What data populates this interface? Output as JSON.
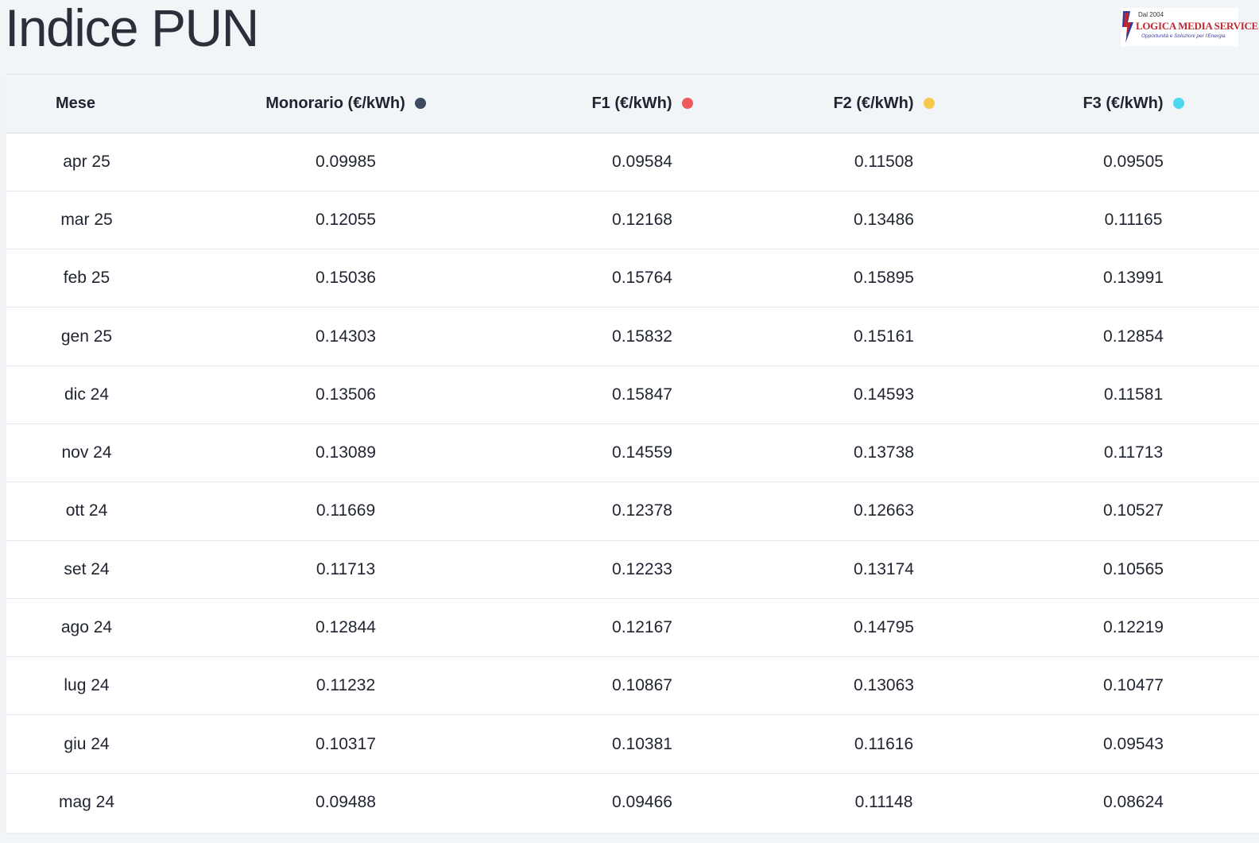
{
  "page": {
    "title": "Indice PUN"
  },
  "logo": {
    "since": "Dal 2004",
    "name": "LOGICA MEDIA SERVICE",
    "tagline": "Opportunità e Soluzioni per l'Energia"
  },
  "table": {
    "headers": {
      "mese": "Mese",
      "monorario": "Monorario (€/kWh)",
      "f1": "F1 (€/kWh)",
      "f2": "F2 (€/kWh)",
      "f3": "F3 (€/kWh)"
    },
    "legend_colors": {
      "monorario": "#3b4a5e",
      "f1": "#ef5a5f",
      "f2": "#f5c84c",
      "f3": "#4dd6ec"
    },
    "rows": [
      {
        "mese": "apr 25",
        "monorario": "0.09985",
        "f1": "0.09584",
        "f2": "0.11508",
        "f3": "0.09505"
      },
      {
        "mese": "mar 25",
        "monorario": "0.12055",
        "f1": "0.12168",
        "f2": "0.13486",
        "f3": "0.11165"
      },
      {
        "mese": "feb 25",
        "monorario": "0.15036",
        "f1": "0.15764",
        "f2": "0.15895",
        "f3": "0.13991"
      },
      {
        "mese": "gen 25",
        "monorario": "0.14303",
        "f1": "0.15832",
        "f2": "0.15161",
        "f3": "0.12854"
      },
      {
        "mese": "dic 24",
        "monorario": "0.13506",
        "f1": "0.15847",
        "f2": "0.14593",
        "f3": "0.11581"
      },
      {
        "mese": "nov 24",
        "monorario": "0.13089",
        "f1": "0.14559",
        "f2": "0.13738",
        "f3": "0.11713"
      },
      {
        "mese": "ott 24",
        "monorario": "0.11669",
        "f1": "0.12378",
        "f2": "0.12663",
        "f3": "0.10527"
      },
      {
        "mese": "set 24",
        "monorario": "0.11713",
        "f1": "0.12233",
        "f2": "0.13174",
        "f3": "0.10565"
      },
      {
        "mese": "ago 24",
        "monorario": "0.12844",
        "f1": "0.12167",
        "f2": "0.14795",
        "f3": "0.12219"
      },
      {
        "mese": "lug 24",
        "monorario": "0.11232",
        "f1": "0.10867",
        "f2": "0.13063",
        "f3": "0.10477"
      },
      {
        "mese": "giu 24",
        "monorario": "0.10317",
        "f1": "0.10381",
        "f2": "0.11616",
        "f3": "0.09543"
      },
      {
        "mese": "mag 24",
        "monorario": "0.09488",
        "f1": "0.09466",
        "f2": "0.11148",
        "f3": "0.08624"
      }
    ]
  }
}
